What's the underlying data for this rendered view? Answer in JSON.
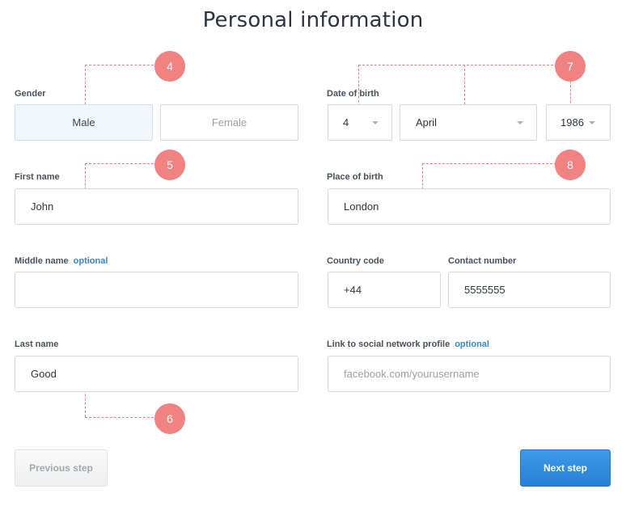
{
  "page": {
    "title": "Personal information"
  },
  "badges": {
    "b4": "4",
    "b5": "5",
    "b6": "6",
    "b7": "7",
    "b8": "8"
  },
  "gender": {
    "label": "Gender",
    "options": [
      "Male",
      "Female"
    ],
    "selected": "Male"
  },
  "first_name": {
    "label": "First name",
    "value": "John"
  },
  "middle_name": {
    "label": "Middle name",
    "optional": "optional",
    "value": ""
  },
  "last_name": {
    "label": "Last name",
    "value": "Good"
  },
  "date_of_birth": {
    "label": "Date of birth",
    "day": "4",
    "month": "April",
    "year": "1986"
  },
  "place_of_birth": {
    "label": "Place of birth",
    "value": "London"
  },
  "country_code": {
    "label": "Country code",
    "value": "+44"
  },
  "contact_number": {
    "label": "Contact number",
    "value": "5555555"
  },
  "social": {
    "label": "Link to social network profile",
    "optional": "optional",
    "placeholder": "facebook.com/yourusername"
  },
  "buttons": {
    "previous": "Previous step",
    "next": "Next step"
  },
  "colors": {
    "badge": "#f08282",
    "accent": "#2f8be0",
    "optional": "#3a86c8",
    "selected_bg": "#f2f8fd"
  }
}
